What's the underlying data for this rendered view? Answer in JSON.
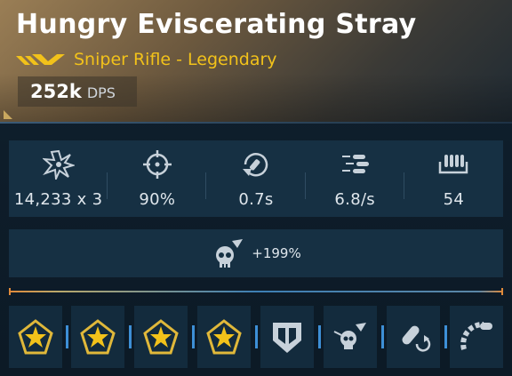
{
  "weapon": {
    "name": "Hungry Eviscerating Stray",
    "subtitle": "Sniper Rifle - Legendary",
    "dps_value": "252k",
    "dps_label": "DPS",
    "rarity_color": "#f2c21a"
  },
  "stats": [
    {
      "icon": "damage-burst-icon",
      "value": "14,233 x 3"
    },
    {
      "icon": "crosshair-accuracy-icon",
      "value": "90%"
    },
    {
      "icon": "reload-time-icon",
      "value": "0.7s"
    },
    {
      "icon": "fire-rate-icon",
      "value": "6.8/s"
    },
    {
      "icon": "magazine-size-icon",
      "value": "54"
    }
  ],
  "perk": {
    "icon": "skull-crit-damage-icon",
    "value": "+199%"
  },
  "mods": [
    {
      "icon": "gold-star-badge-icon"
    },
    {
      "icon": "gold-star-badge-icon"
    },
    {
      "icon": "gold-star-badge-icon"
    },
    {
      "icon": "gold-star-badge-icon"
    },
    {
      "icon": "armor-shield-icon"
    },
    {
      "icon": "skull-critical-icon"
    },
    {
      "icon": "ammo-reload-icon"
    },
    {
      "icon": "ammo-belt-icon"
    }
  ]
}
